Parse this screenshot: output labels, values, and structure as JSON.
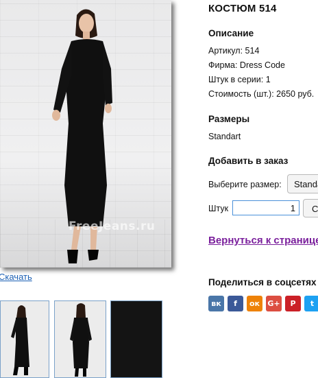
{
  "photo": {
    "watermark": "FreeJeans.ru"
  },
  "download_label": "Скачать",
  "product": {
    "title": "КОСТЮМ 514",
    "description_heading": "Описание",
    "article": "Артикул: 514",
    "brand": "Фирма: Dress Code",
    "series": "Штук в серии: 1",
    "price": "Стоимость (шт.): 2650 руб."
  },
  "sizes": {
    "heading": "Размеры",
    "value": "Standart"
  },
  "order": {
    "heading": "Добавить в заказ",
    "choose_size_label": "Выберите размер:",
    "selected_size": "Standart",
    "qty_label": "Штук",
    "qty_value": "1",
    "button_label": "Сохранить"
  },
  "back_link": "Вернуться к странице",
  "share": {
    "heading": "Поделиться в соцсетях",
    "networks": [
      {
        "icon": "vk-icon",
        "glyph": "вк",
        "color": "#4a76a8"
      },
      {
        "icon": "facebook-icon",
        "glyph": "f",
        "color": "#3b5998"
      },
      {
        "icon": "odnoklassniki-icon",
        "glyph": "ок",
        "color": "#ee8208"
      },
      {
        "icon": "google-plus-icon",
        "glyph": "G+",
        "color": "#dc4e41"
      },
      {
        "icon": "pinterest-icon",
        "glyph": "P",
        "color": "#cb2027"
      },
      {
        "icon": "twitter-icon",
        "glyph": "t",
        "color": "#1da1f2"
      }
    ]
  }
}
